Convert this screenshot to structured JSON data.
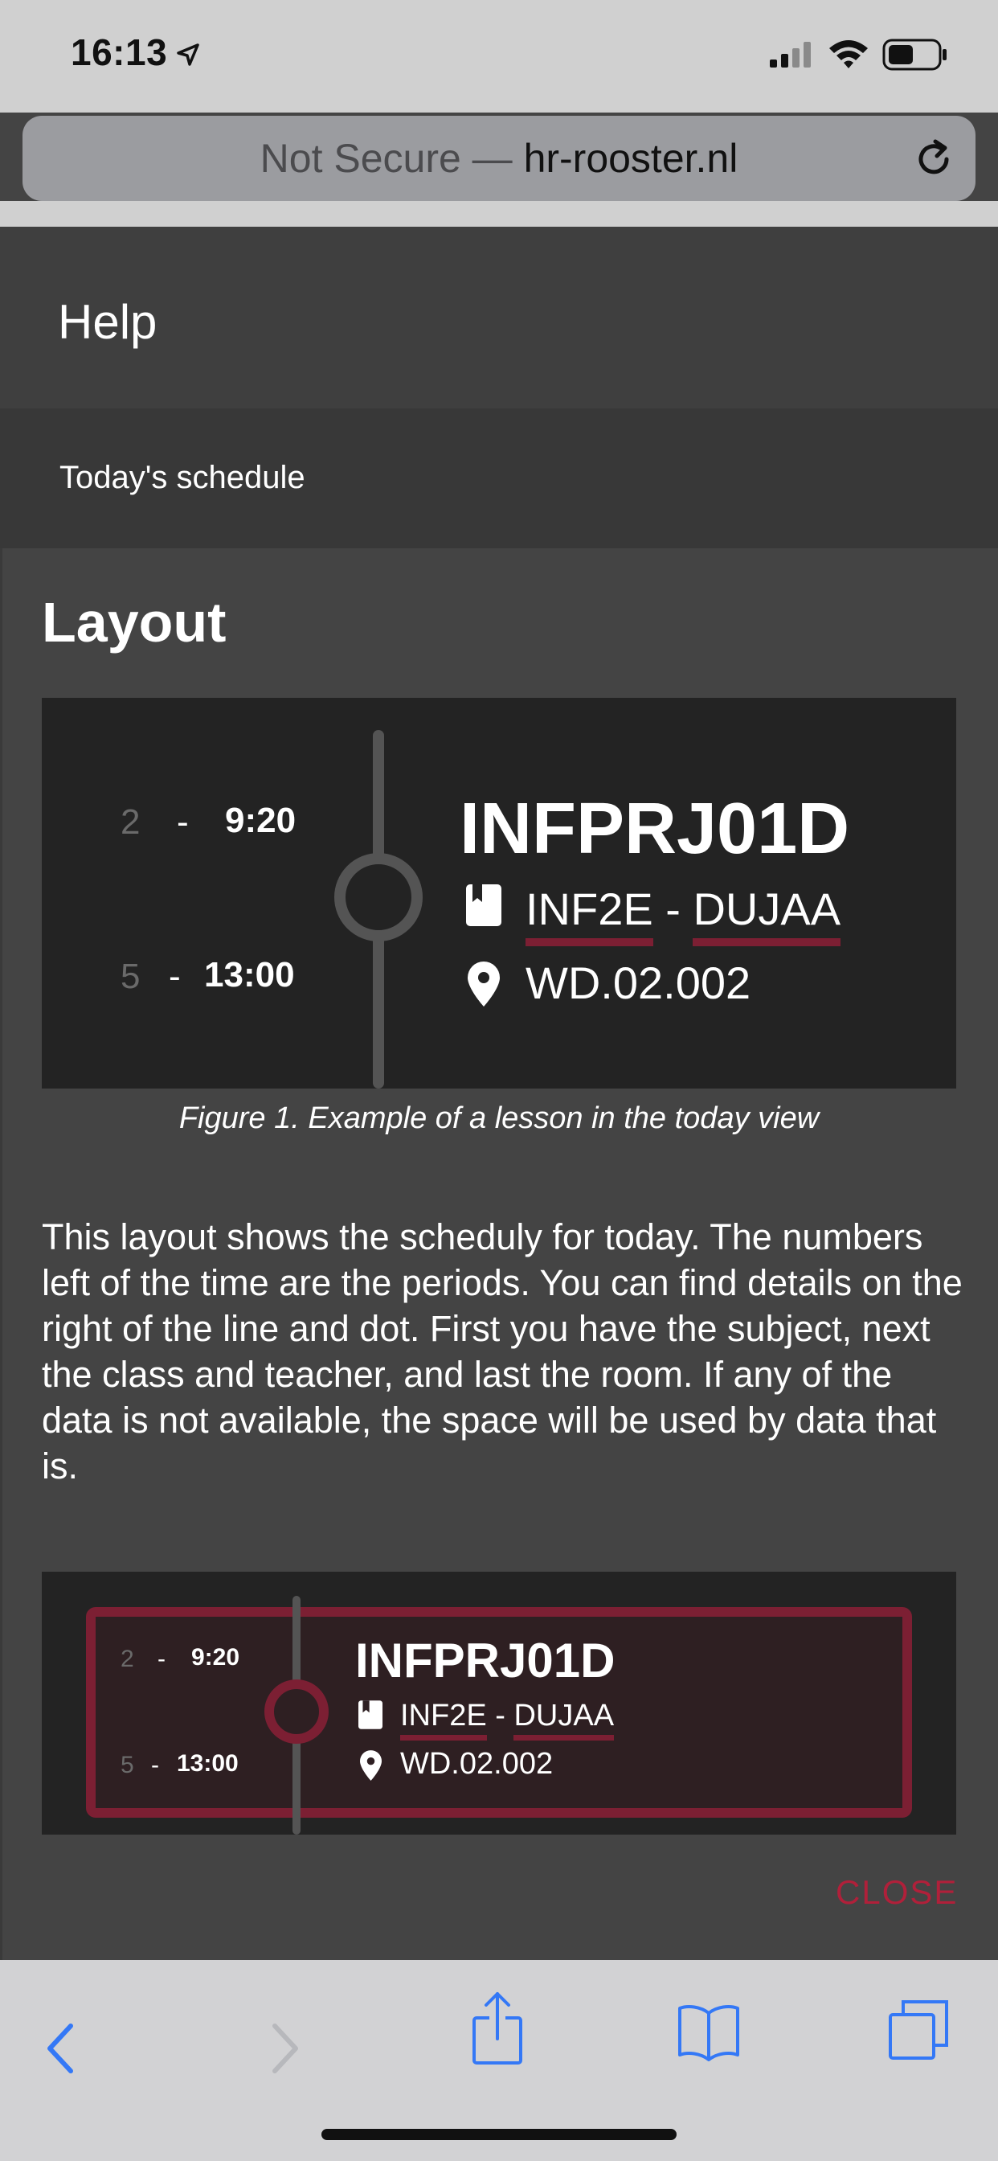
{
  "status_bar": {
    "time": "16:13"
  },
  "browser": {
    "address_prefix": "Not Secure — ",
    "address_domain": "hr-rooster.nl"
  },
  "header": {
    "title": "Help"
  },
  "subheader": {
    "title": "Today's schedule"
  },
  "dialog": {
    "heading": "Layout",
    "figure1": {
      "period_start": "2",
      "time_start": "9:20",
      "period_end": "5",
      "time_end": "13:00",
      "subject": "INFPRJ01D",
      "class": "INF2E",
      "teacher": "DUJAA",
      "room": "WD.02.002",
      "dash": "-"
    },
    "caption": "Figure 1. Example of a lesson in the today view",
    "description": "This layout shows the scheduly for today. The numbers left of the time are the periods. You can find details on the right of the line and dot. First you have the subject, next the class and teacher, and last the room. If any of the data is not available, the space will be used by data that is.",
    "figure2": {
      "period_start": "2",
      "time_start": "9:20",
      "period_end": "5",
      "time_end": "13:00",
      "subject": "INFPRJ01D",
      "class": "INF2E",
      "teacher": "DUJAA",
      "room": "WD.02.002",
      "dash": "-"
    },
    "close_label": "CLOSE"
  },
  "colors": {
    "accent_red": "#b0203a",
    "underline_red": "#7c1f33",
    "ios_blue": "#3478f6"
  },
  "toolbar": {
    "icons": [
      "back-icon",
      "forward-icon",
      "share-icon",
      "bookmarks-icon",
      "tabs-icon"
    ]
  }
}
